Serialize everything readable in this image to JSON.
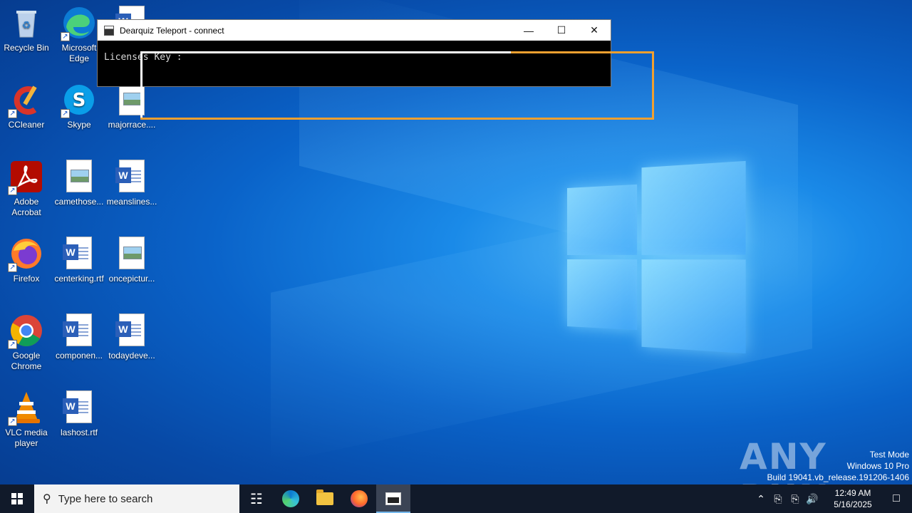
{
  "desktop": {
    "icons": [
      {
        "label": "Recycle Bin"
      },
      {
        "label": "Microsoft Edge"
      },
      {
        "label": "CCleaner"
      },
      {
        "label": "Skype"
      },
      {
        "label": "majorrace...."
      },
      {
        "label": "Adobe Acrobat"
      },
      {
        "label": "camethose..."
      },
      {
        "label": "meanslines..."
      },
      {
        "label": "Firefox"
      },
      {
        "label": "centerking.rtf"
      },
      {
        "label": "oncepictur..."
      },
      {
        "label": "Google Chrome"
      },
      {
        "label": "componen..."
      },
      {
        "label": "todaydeve..."
      },
      {
        "label": "VLC media player"
      },
      {
        "label": "lashost.rtf"
      }
    ]
  },
  "window": {
    "title": "Dearquiz Teleport - connect",
    "console_text": "Licenses Key :",
    "minimize_glyph": "—",
    "maximize_glyph": "☐",
    "close_glyph": "✕"
  },
  "watermark": {
    "brand": "ANY RUN",
    "mode": "Test Mode",
    "os": "Windows 10 Pro",
    "build": "Build 19041.vb_release.191206-1406"
  },
  "taskbar": {
    "search_placeholder": "Type here to search",
    "time": "12:49 AM",
    "date": "5/16/2025",
    "icons": [
      "start-icon",
      "task-view-icon",
      "edge-icon",
      "file-explorer-icon",
      "firefox-icon",
      "console-icon"
    ]
  },
  "colors": {
    "highlight": "#f0a030",
    "taskbar": "#111a2a"
  }
}
